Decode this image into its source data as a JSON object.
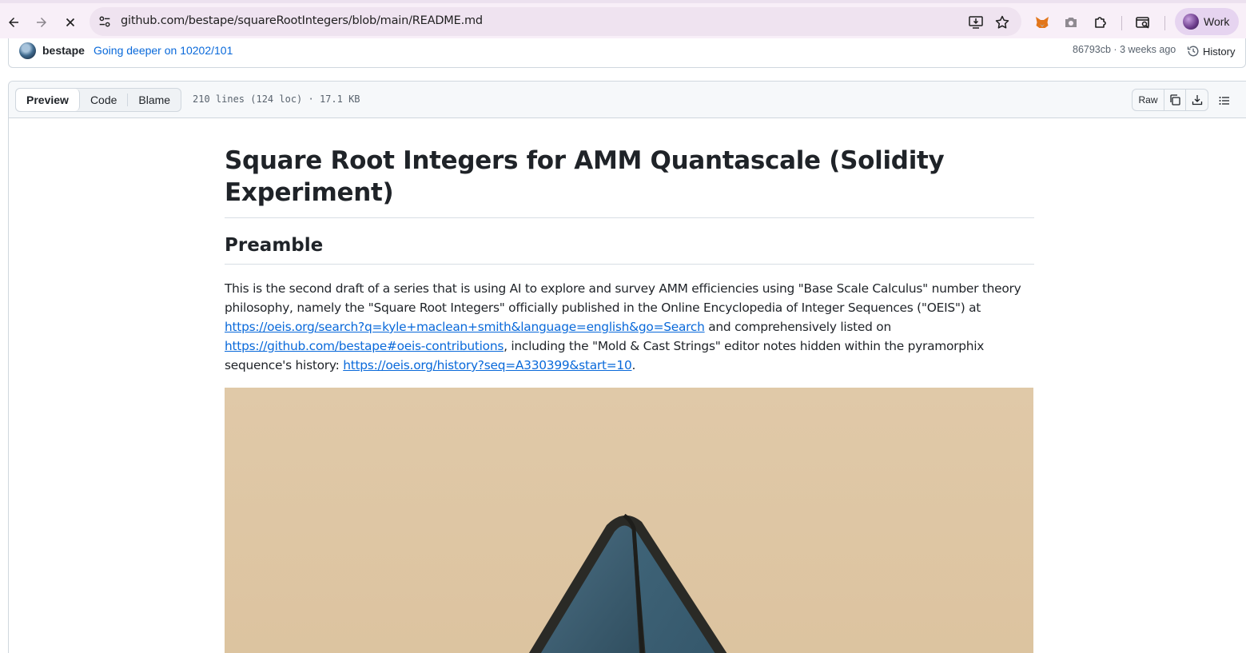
{
  "browser": {
    "url": "github.com/bestape/squareRootIntegers/blob/main/README.md",
    "profile_label": "Work",
    "icons": [
      "back-icon",
      "forward-icon",
      "stop-loading-icon",
      "site-settings-icon",
      "install-app-icon",
      "bookmark-star-icon",
      "fox-extension-icon",
      "camera-extension-icon",
      "extensions-puzzle-icon",
      "tab-search-icon"
    ]
  },
  "commit": {
    "author": "bestape",
    "message": "Going deeper on 10202/101",
    "meta": "86793cb · 3 weeks ago",
    "history_label": "History"
  },
  "file": {
    "tabs": [
      "Preview",
      "Code",
      "Blame"
    ],
    "active_tab": "Preview",
    "info": "210 lines (124 loc) · 17.1 KB",
    "raw_label": "Raw",
    "actions": [
      "copy-icon",
      "download-icon",
      "outline-list-icon"
    ]
  },
  "readme": {
    "title": "Square Root Integers for AMM Quantascale (Solidity Experiment)",
    "heading": "Preamble",
    "paragraph": {
      "t1": "This is the second draft of a series that is using AI to explore and survey AMM efficiencies using \"Base Scale Calculus\" number theory philosophy, namely the \"Square Root Integers\" officially published in the Online Encyclopedia of Integer Sequences (\"OEIS\") at ",
      "link1": "https://oeis.org/search?q=kyle+maclean+smith&language=english&go=Search",
      "t2": " and comprehensively listed on ",
      "link2": "https://github.com/bestape#oeis-contributions",
      "t3": ", including the \"Mold & Cast Strings\" editor notes hidden within the pyramorphix sequence's history: ",
      "link3": "https://oeis.org/history?seq=A330399&start=10",
      "t4": "."
    },
    "image_colors": {
      "background": "#e0c9a7",
      "pyramid_face": "#3e6275",
      "pyramid_edge": "#2a2a26"
    }
  }
}
